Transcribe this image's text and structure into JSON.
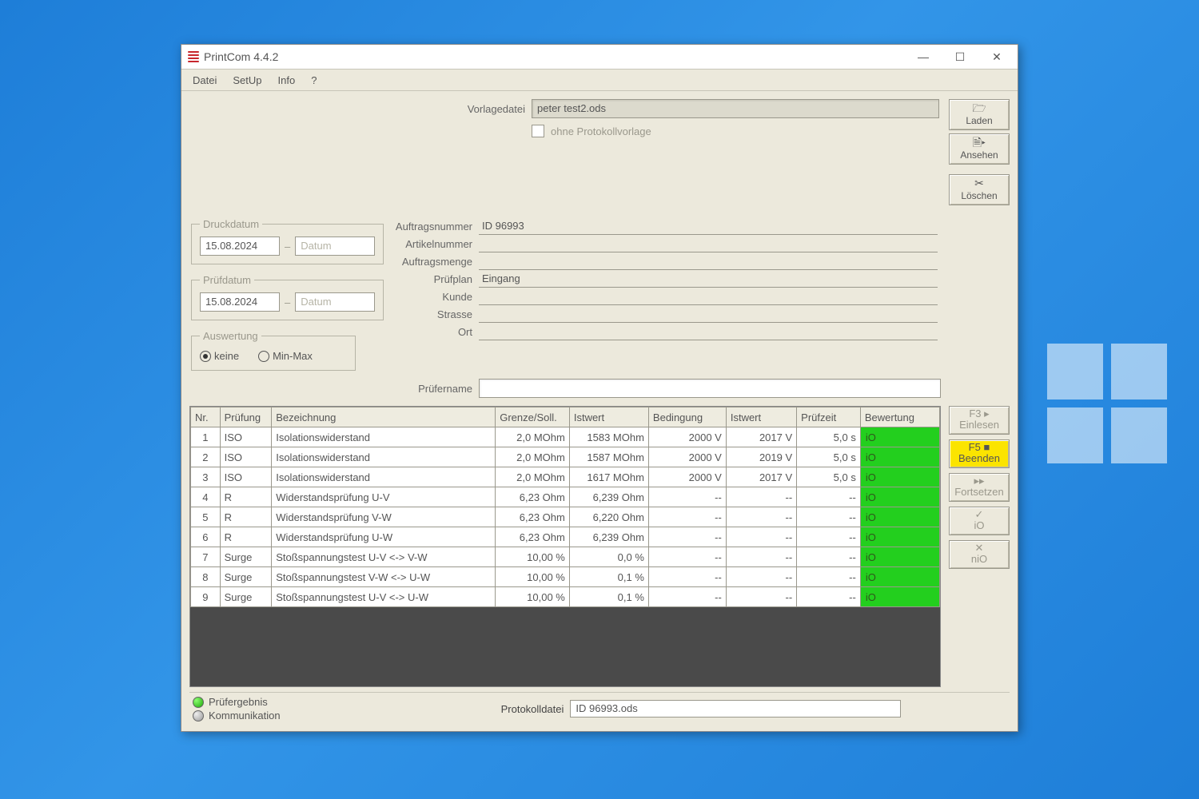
{
  "window": {
    "title": "PrintCom 4.4.2"
  },
  "menu": {
    "datei": "Datei",
    "setup": "SetUp",
    "info": "Info",
    "help": "?"
  },
  "template": {
    "label": "Vorlagedatei",
    "value": "peter test2.ods",
    "ohne_label": "ohne Protokollvorlage"
  },
  "sidebuttons": {
    "laden": "Laden",
    "ansehen": "Ansehen",
    "loeschen": "Löschen"
  },
  "druckdatum": {
    "legend": "Druckdatum",
    "value": "15.08.2024",
    "placeholder": "Datum",
    "sep": "–"
  },
  "pruefdatum": {
    "legend": "Prüfdatum",
    "value": "15.08.2024",
    "placeholder": "Datum",
    "sep": "–"
  },
  "auswertung": {
    "legend": "Auswertung",
    "keine": "keine",
    "minmax": "Min-Max"
  },
  "meta": {
    "auftragsnummer_label": "Auftragsnummer",
    "auftragsnummer": "ID 96993",
    "artikelnummer_label": "Artikelnummer",
    "artikelnummer": "",
    "auftragsmenge_label": "Auftragsmenge",
    "auftragsmenge": "",
    "pruefplan_label": "Prüfplan",
    "pruefplan": "Eingang",
    "kunde_label": "Kunde",
    "kunde": "",
    "strasse_label": "Strasse",
    "strasse": "",
    "ort_label": "Ort",
    "ort": ""
  },
  "pruefername_label": "Prüfername",
  "table": {
    "headers": {
      "nr": "Nr.",
      "pruefung": "Prüfung",
      "bezeichnung": "Bezeichnung",
      "grenze": "Grenze/Soll.",
      "istwert1": "Istwert",
      "bedingung": "Bedingung",
      "istwert2": "Istwert",
      "pruefzeit": "Prüfzeit",
      "bewertung": "Bewertung"
    },
    "rows": [
      {
        "nr": "1",
        "prf": "ISO",
        "bez": "Isolationswiderstand",
        "gs": "2,0 MOhm",
        "iw1": "1583 MOhm",
        "bed": "2000 V",
        "iw2": "2017 V",
        "pz": "5,0 s",
        "bw": "iO"
      },
      {
        "nr": "2",
        "prf": "ISO",
        "bez": "Isolationswiderstand",
        "gs": "2,0 MOhm",
        "iw1": "1587 MOhm",
        "bed": "2000 V",
        "iw2": "2019 V",
        "pz": "5,0 s",
        "bw": "iO"
      },
      {
        "nr": "3",
        "prf": "ISO",
        "bez": "Isolationswiderstand",
        "gs": "2,0 MOhm",
        "iw1": "1617 MOhm",
        "bed": "2000 V",
        "iw2": "2017 V",
        "pz": "5,0 s",
        "bw": "iO"
      },
      {
        "nr": "4",
        "prf": "R",
        "bez": "Widerstandsprüfung U-V",
        "gs": "6,23 Ohm",
        "iw1": "6,239 Ohm",
        "bed": "--",
        "iw2": "--",
        "pz": "--",
        "bw": "iO"
      },
      {
        "nr": "5",
        "prf": "R",
        "bez": "Widerstandsprüfung V-W",
        "gs": "6,23 Ohm",
        "iw1": "6,220 Ohm",
        "bed": "--",
        "iw2": "--",
        "pz": "--",
        "bw": "iO"
      },
      {
        "nr": "6",
        "prf": "R",
        "bez": "Widerstandsprüfung U-W",
        "gs": "6,23 Ohm",
        "iw1": "6,239 Ohm",
        "bed": "--",
        "iw2": "--",
        "pz": "--",
        "bw": "iO"
      },
      {
        "nr": "7",
        "prf": "Surge",
        "bez": "Stoßspannungstest U-V <-> V-W",
        "gs": "10,00 %",
        "iw1": "0,0 %",
        "bed": "--",
        "iw2": "--",
        "pz": "--",
        "bw": "iO"
      },
      {
        "nr": "8",
        "prf": "Surge",
        "bez": "Stoßspannungstest V-W <-> U-W",
        "gs": "10,00 %",
        "iw1": "0,1 %",
        "bed": "--",
        "iw2": "--",
        "pz": "--",
        "bw": "iO"
      },
      {
        "nr": "9",
        "prf": "Surge",
        "bez": "Stoßspannungstest U-V <-> U-W",
        "gs": "10,00 %",
        "iw1": "0,1 %",
        "bed": "--",
        "iw2": "--",
        "pz": "--",
        "bw": "iO"
      }
    ]
  },
  "actions": {
    "einlesen_key": "F3  ▸",
    "einlesen": "Einlesen",
    "beenden_key": "F5  ■",
    "beenden": "Beenden",
    "fortsetzen_glyph": "▸▸",
    "fortsetzen": "Fortsetzen",
    "io_glyph": "✓",
    "io": "iO",
    "nio_glyph": "✕",
    "nio": "niO"
  },
  "status": {
    "pruefergebnis": "Prüfergebnis",
    "kommunikation": "Kommunikation",
    "protokolldatei_label": "Protokolldatei",
    "protokolldatei": "ID 96993.ods"
  }
}
